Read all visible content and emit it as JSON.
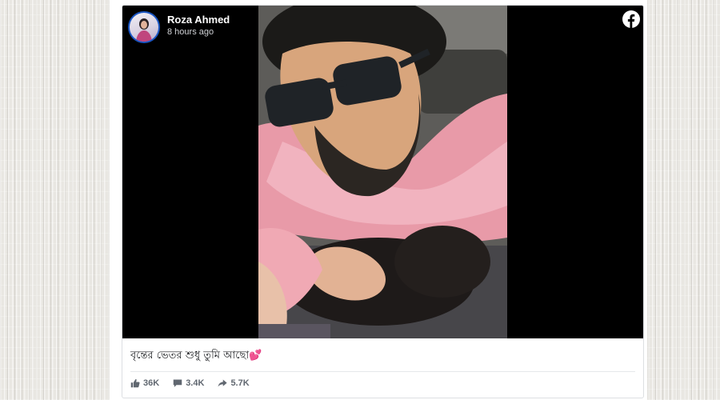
{
  "post": {
    "author_name": "Roza Ahmed",
    "time_ago": "8 hours ago",
    "caption": "বৃন্তের ভেতর শুধু তুমি আছো💕"
  },
  "stats": {
    "likes": "36K",
    "comments": "3.4K",
    "shares": "5.7K"
  },
  "icons": {
    "brand": "facebook-icon",
    "like": "thumbs-up-icon",
    "comment": "comment-icon",
    "share": "share-icon"
  },
  "colors": {
    "facebook_brand": "#ffffff",
    "avatar_ring": "#1a56c4",
    "stat_text": "#606770",
    "media_background": "#000000"
  }
}
